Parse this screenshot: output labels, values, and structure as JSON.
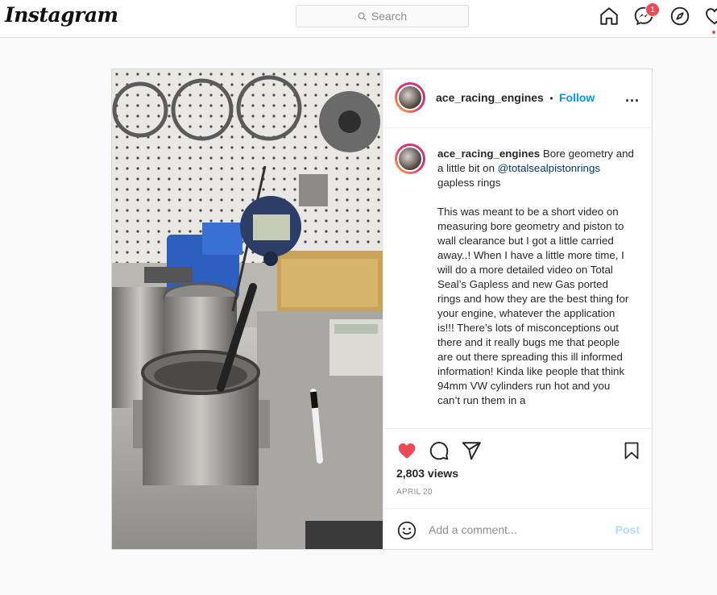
{
  "header": {
    "logo": "Instagram",
    "search_placeholder": "Search",
    "notification_count": "1",
    "icons": [
      "home-icon",
      "messenger-icon",
      "explore-icon",
      "heart-icon"
    ]
  },
  "post": {
    "username": "ace_racing_engines",
    "separator": "•",
    "follow_label": "Follow",
    "more_label": "...",
    "caption": {
      "username": "ace_racing_engines",
      "intro": " Bore geometry and a little bit on ",
      "mention": "@totalsealpistonrings",
      "intro_end": " gapless rings",
      "body": "This was meant to be a short video on measuring bore geometry and piston to wall clearance but I got a little carried away..! When I have a little more time, I will do a more detailed video on Total Seal’s Gapless and new Gas ported rings and how they are the best thing for your engine, whatever the application is!!! There’s lots of misconceptions out there and it really bugs me that people are out there spreading this ill informed information! Kinda like people that think 94mm VW cylinders run hot and you can’t run them in a"
    },
    "views": "2,803 views",
    "date": "APRIL 20",
    "comment_placeholder": "Add a comment...",
    "post_button": "Post",
    "liked": true,
    "colors": {
      "like": "#ed4956",
      "link": "#0095f6",
      "mention": "#00376b"
    }
  }
}
